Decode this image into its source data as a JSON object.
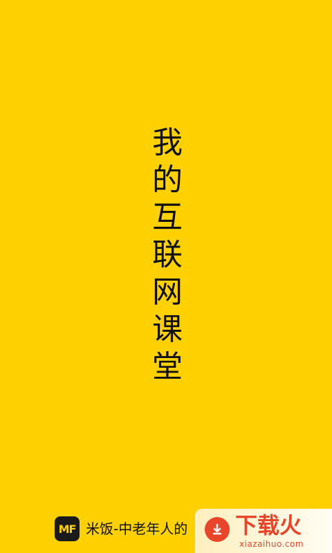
{
  "splash": {
    "title_chars": [
      "我",
      "的",
      "互",
      "联",
      "网",
      "课",
      "堂"
    ]
  },
  "footer": {
    "logo_text": "MF",
    "app_name": "米饭-中老年人的"
  },
  "watermark": {
    "brand": "下载火",
    "url": "xiazaihuo.com"
  },
  "colors": {
    "background": "#FFD100",
    "text": "#111111",
    "watermark_accent": "#E8452B"
  }
}
